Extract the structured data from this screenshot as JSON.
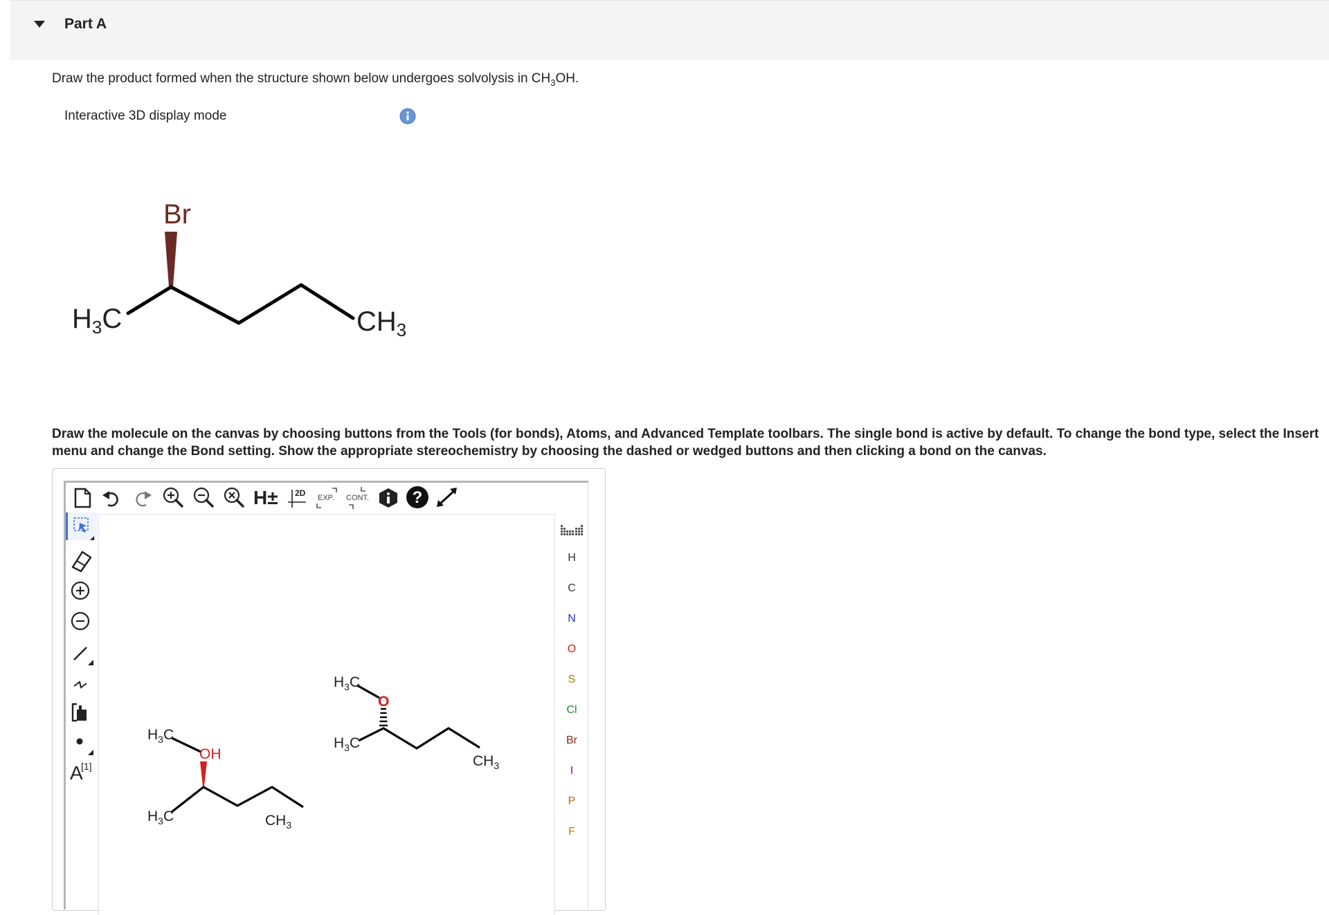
{
  "part": {
    "title": "Part A"
  },
  "question": {
    "prefix": "Draw the product formed when the structure shown below undergoes solvolysis in CH",
    "sub": "3",
    "suffix": "OH."
  },
  "display_mode": {
    "label": "Interactive 3D display mode"
  },
  "structure": {
    "br": "Br",
    "left_h": "H",
    "left_sub": "3",
    "left_c": "C",
    "right_ch": "CH",
    "right_sub": "3"
  },
  "instructions": "Draw the molecule on the canvas by choosing buttons from the Tools (for bonds), Atoms, and Advanced Template toolbars. The single bond is active by default. To change the bond type, select the Insert menu and change the Bond setting. Show the appropriate stereochemistry by choosing the dashed or wedged buttons and then clicking a bond on the canvas.",
  "toolbar": {
    "h_label": "H±",
    "clean2d_label": "2D",
    "expand_label": "EXP.",
    "contract_label": "CONT."
  },
  "left_toolbar": {
    "atom_label": "A",
    "atom_sup": "[1]"
  },
  "atoms": [
    "H",
    "C",
    "N",
    "O",
    "S",
    "Cl",
    "Br",
    "I",
    "P",
    "F"
  ],
  "atom_colors": {
    "H": "#333333",
    "C": "#333333",
    "N": "#2430c8",
    "O": "#d42020",
    "S": "#a08000",
    "Cl": "#1f8a1f",
    "Br": "#8a2a1a",
    "I": "#6a1a9a",
    "P": "#c86400",
    "F": "#c08000"
  },
  "canvas": {
    "mol1": {
      "h3c_top": "H",
      "h3c_top_sub": "3",
      "h3c_top_c": "C",
      "oh": "OH",
      "h3c_bottom": "H",
      "h3c_bottom_sub": "3",
      "h3c_bottom_c": "C",
      "ch3": "CH",
      "ch3_sub": "3"
    },
    "mol2": {
      "h3c_top": "H",
      "h3c_top_sub": "3",
      "h3c_top_c": "C",
      "o": "O",
      "h3c_left": "H",
      "h3c_left_sub": "3",
      "h3c_left_c": "C",
      "ch3": "CH",
      "ch3_sub": "3"
    }
  }
}
